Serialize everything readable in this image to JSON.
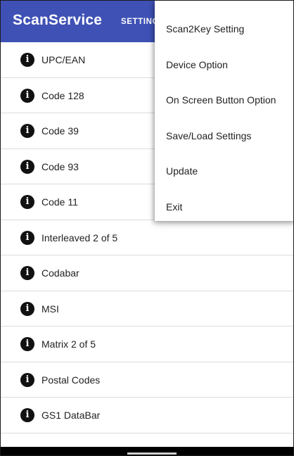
{
  "appbar": {
    "title": "ScanService",
    "tab_label": "SETTINGS"
  },
  "list": {
    "icon": "info-icon",
    "icon_glyph": "i",
    "items": [
      {
        "label": "UPC/EAN"
      },
      {
        "label": "Code 128"
      },
      {
        "label": "Code 39"
      },
      {
        "label": "Code 93"
      },
      {
        "label": "Code 11"
      },
      {
        "label": "Interleaved 2 of 5"
      },
      {
        "label": "Codabar"
      },
      {
        "label": "MSI"
      },
      {
        "label": "Matrix 2 of 5"
      },
      {
        "label": "Postal Codes"
      },
      {
        "label": "GS1 DataBar"
      }
    ]
  },
  "menu": {
    "items": [
      {
        "label": "Scan2Key Setting"
      },
      {
        "label": "Device Option"
      },
      {
        "label": "On Screen Button Option"
      },
      {
        "label": "Save/Load Settings"
      },
      {
        "label": "Update"
      },
      {
        "label": "Exit"
      }
    ]
  },
  "colors": {
    "appbar": "#3f51b5",
    "icon": "#111111",
    "divider": "#dcdcdc"
  }
}
